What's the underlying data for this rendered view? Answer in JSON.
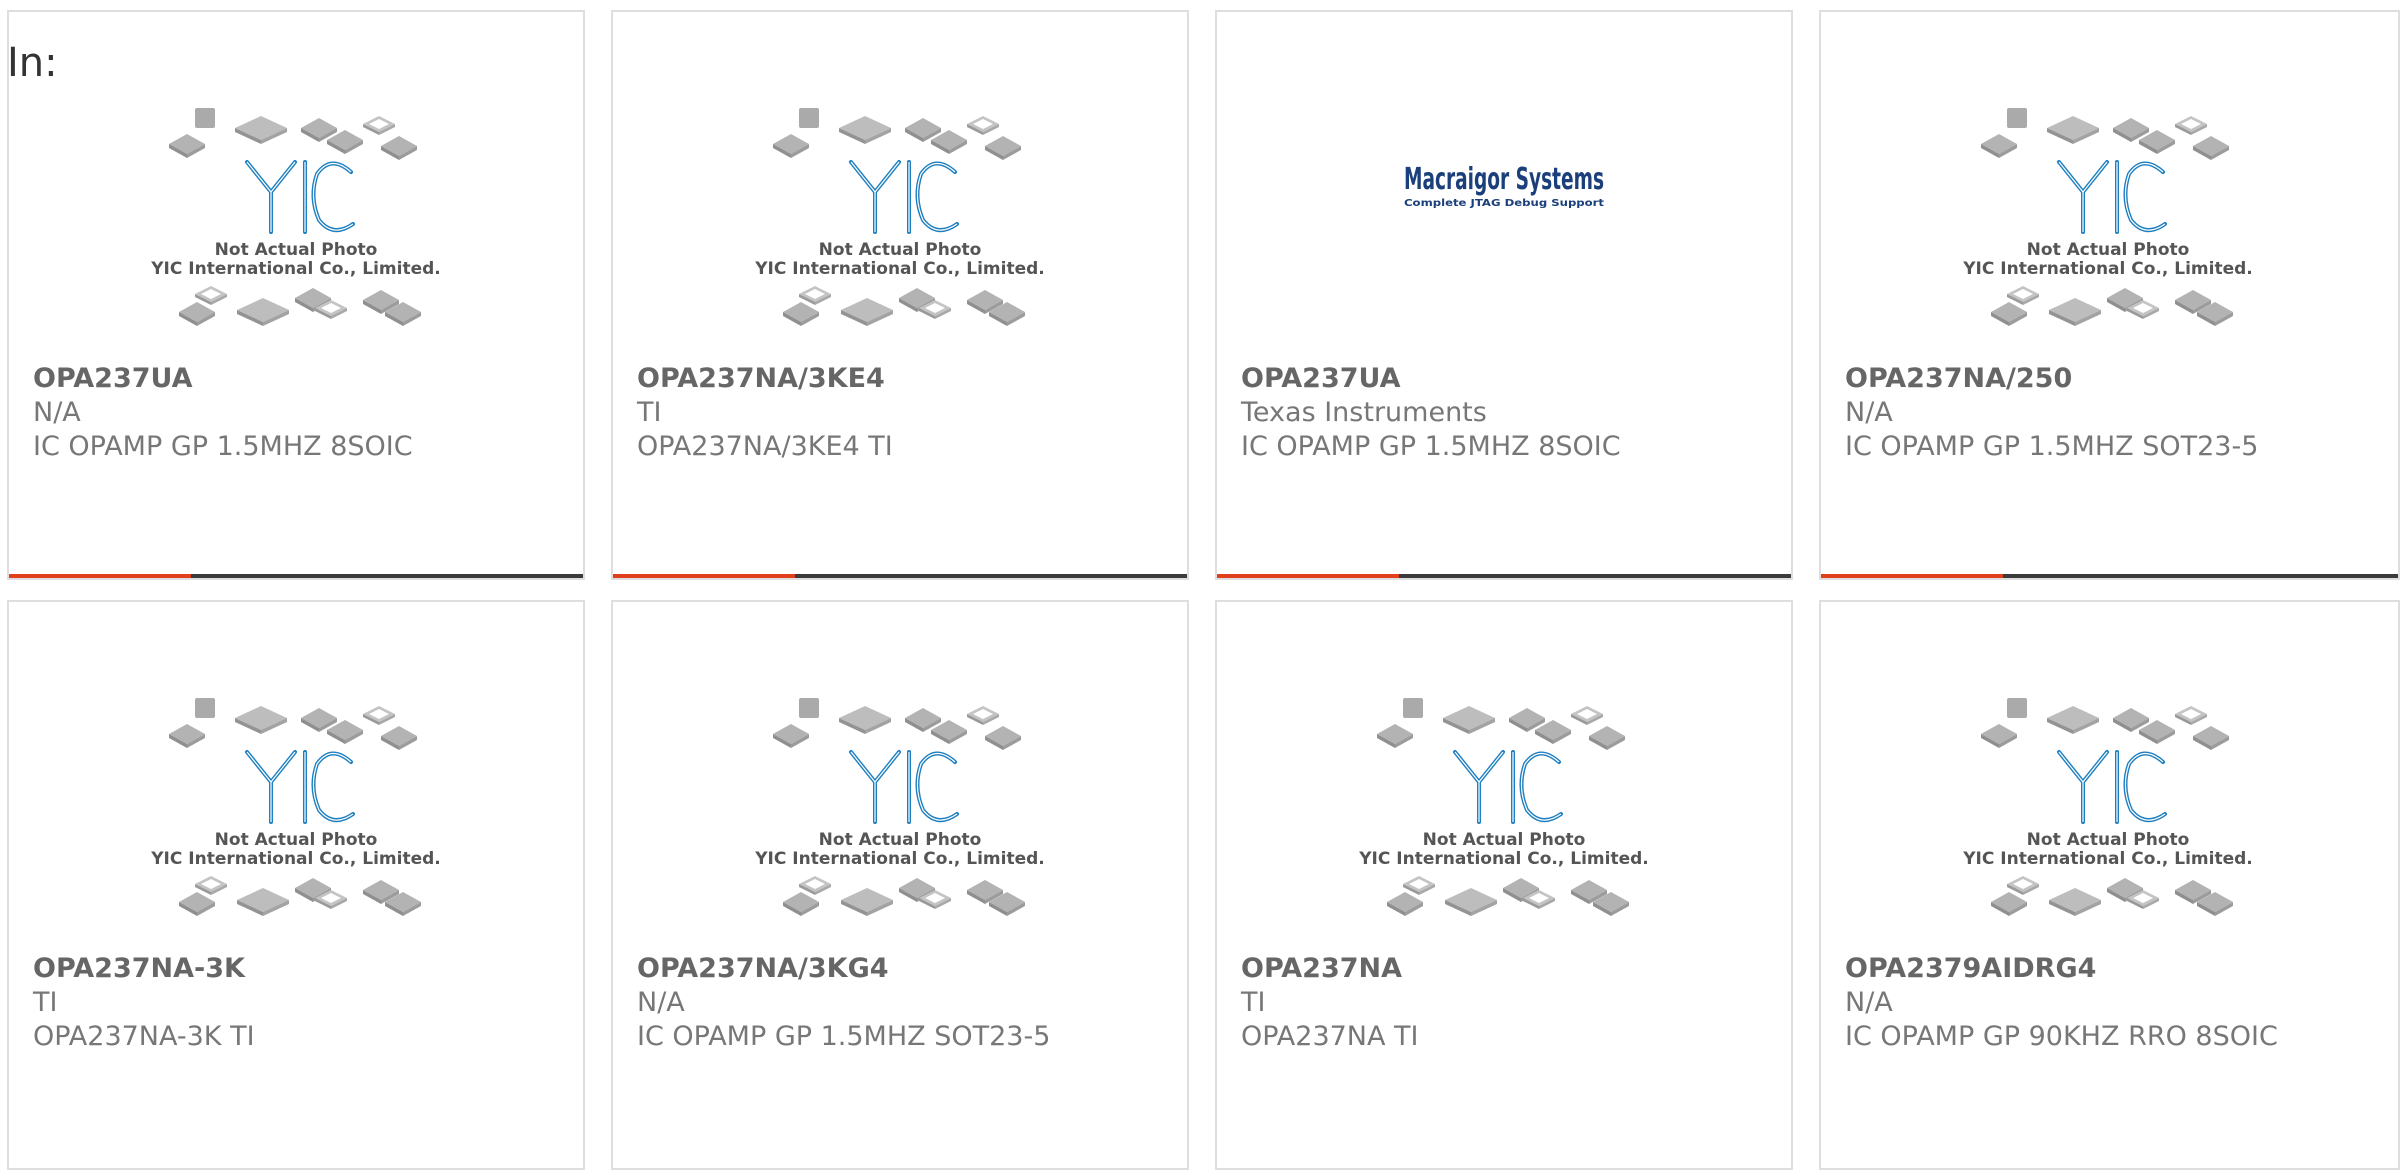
{
  "header": {
    "in_label": "In:"
  },
  "placeholder": {
    "line1": "Not Actual Photo",
    "line2": "YIC International Co., Limited."
  },
  "macraigor": {
    "name": "Macraigor Systems",
    "tagline": "Complete JTAG Debug Support"
  },
  "colors": {
    "accent": "#e2401c",
    "bar": "#3b3b3b",
    "logo_blue": "#1e7fc0"
  },
  "products": [
    {
      "part": "OPA237UA",
      "manufacturer": "N/A",
      "description": "IC OPAMP GP 1.5MHZ 8SOIC",
      "image": "yic-placeholder"
    },
    {
      "part": "OPA237NA/3KE4",
      "manufacturer": "TI",
      "description": "OPA237NA/3KE4 TI",
      "image": "yic-placeholder"
    },
    {
      "part": "OPA237UA",
      "manufacturer": "Texas Instruments",
      "description": "IC OPAMP GP 1.5MHZ 8SOIC",
      "image": "macraigor-logo"
    },
    {
      "part": "OPA237NA/250",
      "manufacturer": "N/A",
      "description": "IC OPAMP GP 1.5MHZ SOT23-5",
      "image": "yic-placeholder"
    },
    {
      "part": "OPA237NA-3K",
      "manufacturer": "TI",
      "description": "OPA237NA-3K TI",
      "image": "yic-placeholder"
    },
    {
      "part": "OPA237NA/3KG4",
      "manufacturer": "N/A",
      "description": "IC OPAMP GP 1.5MHZ SOT23-5",
      "image": "yic-placeholder"
    },
    {
      "part": "OPA237NA",
      "manufacturer": "TI",
      "description": "OPA237NA TI",
      "image": "yic-placeholder"
    },
    {
      "part": "OPA2379AIDRG4",
      "manufacturer": "N/A",
      "description": "IC OPAMP GP 90KHZ RRO 8SOIC",
      "image": "yic-placeholder"
    }
  ]
}
